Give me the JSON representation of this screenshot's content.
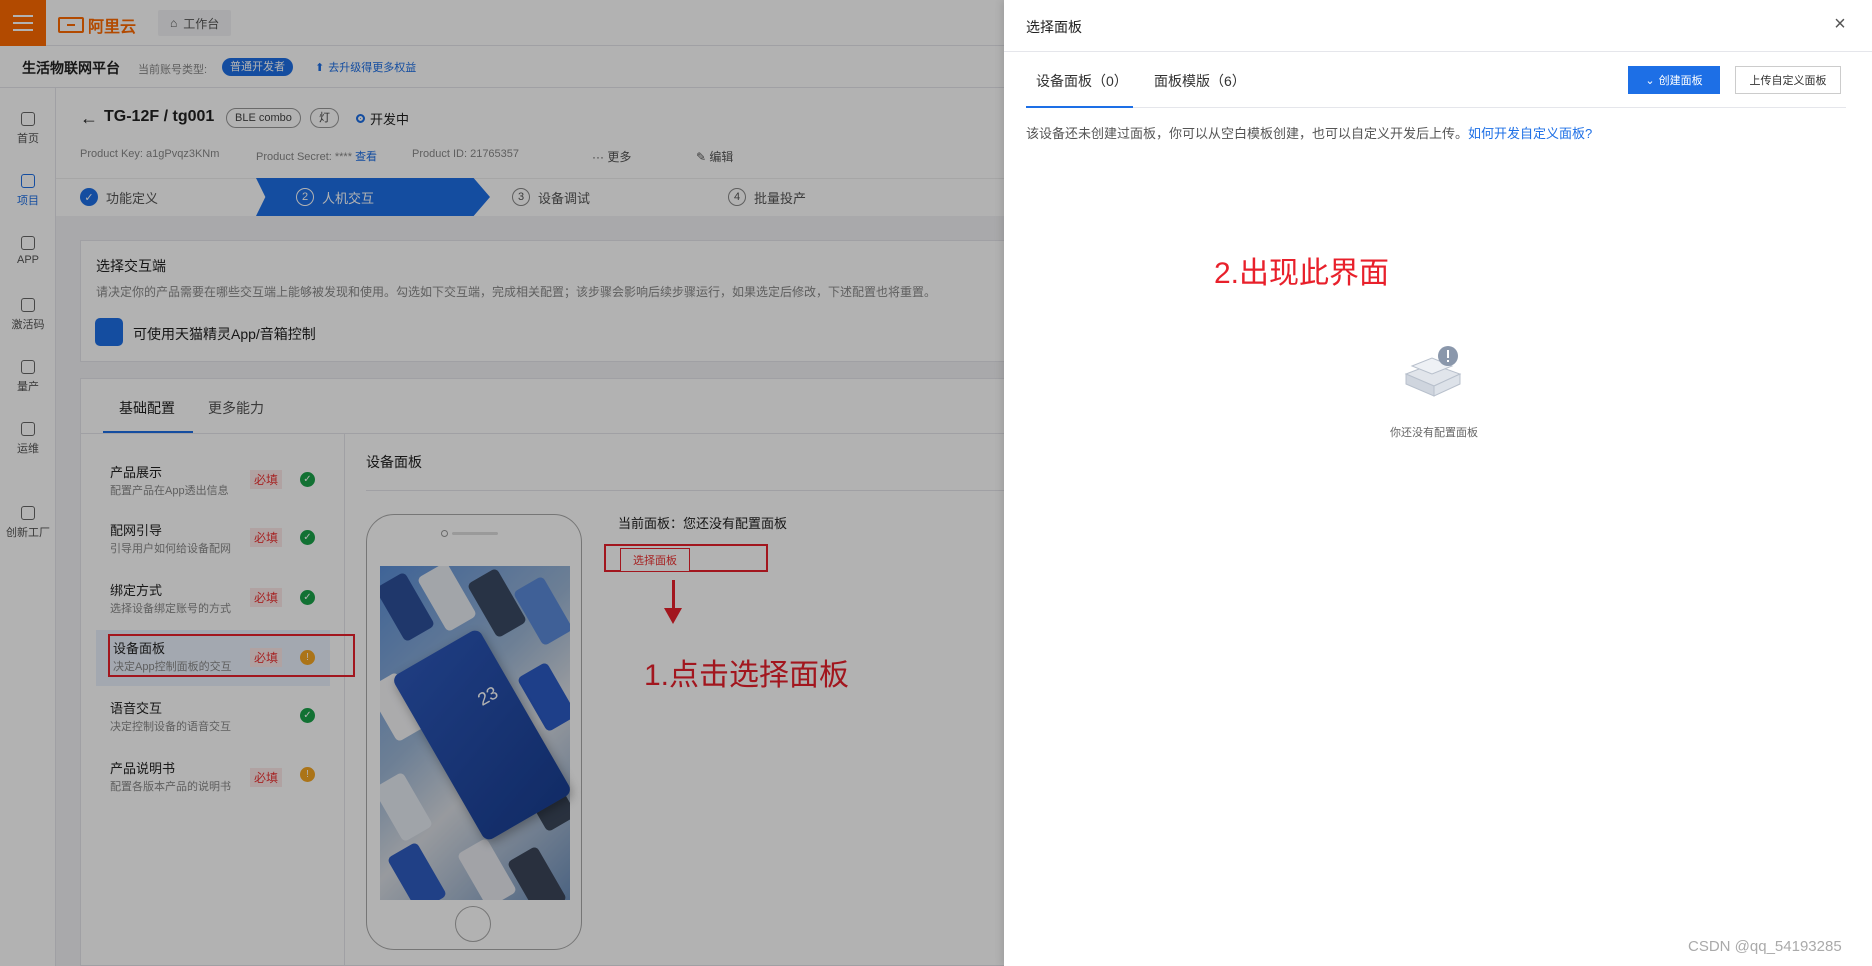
{
  "topbar": {
    "logo": "阿里云",
    "workbench": "工作台"
  },
  "subheader": {
    "platform": "生活物联网平台",
    "account_label": "当前账号类型:",
    "account_type": "普通开发者",
    "upgrade": "去升级得更多权益"
  },
  "nav": [
    {
      "label": "首页",
      "icon": "home-icon"
    },
    {
      "label": "项目",
      "icon": "project-icon"
    },
    {
      "label": "APP",
      "icon": "app-icon"
    },
    {
      "label": "激活码",
      "icon": "shield-icon"
    },
    {
      "label": "量产",
      "icon": "layers-icon"
    },
    {
      "label": "运维",
      "icon": "ops-icon"
    },
    {
      "label": "创新工厂",
      "icon": "factory-icon"
    }
  ],
  "product": {
    "name": "TG-12F",
    "sep": "/",
    "device": "tg001",
    "tags": [
      "BLE combo",
      "灯"
    ],
    "status": "开发中",
    "product_key": "Product Key:  a1gPvqz3KNm",
    "product_secret": "Product Secret: ****",
    "view": "查看",
    "product_id": "Product ID:  21765357",
    "more": "更多",
    "edit": "编辑"
  },
  "steps": [
    {
      "num": "✓",
      "label": "功能定义"
    },
    {
      "num": "2",
      "label": "人机交互"
    },
    {
      "num": "3",
      "label": "设备调试"
    },
    {
      "num": "4",
      "label": "批量投产"
    }
  ],
  "interaction": {
    "title": "选择交互端",
    "desc": "请决定你的产品需要在哪些交互端上能够被发现和使用。勾选如下交互端，完成相关配置；该步骤会影响后续步骤运行，如果选定后修改，下述配置也将重置。",
    "tmall": "可使用天猫精灵App/音箱控制"
  },
  "config_tabs": [
    "基础配置",
    "更多能力"
  ],
  "configs": [
    {
      "title": "产品展示",
      "sub": "配置产品在App透出信息",
      "required": "必填",
      "status": "ok"
    },
    {
      "title": "配网引导",
      "sub": "引导用户如何给设备配网",
      "required": "必填",
      "status": "ok"
    },
    {
      "title": "绑定方式",
      "sub": "选择设备绑定账号的方式",
      "required": "必填",
      "status": "ok"
    },
    {
      "title": "设备面板",
      "sub": "决定App控制面板的交互",
      "required": "必填",
      "status": "warn"
    },
    {
      "title": "语音交互",
      "sub": "决定控制设备的语音交互",
      "required": "",
      "status": "ok"
    },
    {
      "title": "产品说明书",
      "sub": "配置各版本产品的说明书",
      "required": "必填",
      "status": "warn"
    }
  ],
  "panel_section": {
    "title": "设备面板",
    "phone_temp": "23",
    "current": "当前面板：您还没有配置面板",
    "select_btn": "选择面板",
    "annotation": "1.点击选择面板"
  },
  "drawer": {
    "title": "选择面板",
    "close": "×",
    "tabs": [
      "设备面板（0）",
      "面板模版（6）"
    ],
    "create_btn": "创建面板",
    "upload_btn": "上传自定义面板",
    "info": "该设备还未创建过面板，你可以从空白模板创建，也可以自定义开发后上传。",
    "info_link": "如何开发自定义面板?",
    "annotation": "2.出现此界面",
    "empty_text": "你还没有配置面板"
  },
  "watermark": "CSDN @qq_54193285",
  "colors": {
    "brand": "#ff6a00",
    "primary": "#1d6fe6",
    "annotation_red": "#e8202b",
    "ok": "#1aa34a",
    "warn": "#f5a623"
  }
}
